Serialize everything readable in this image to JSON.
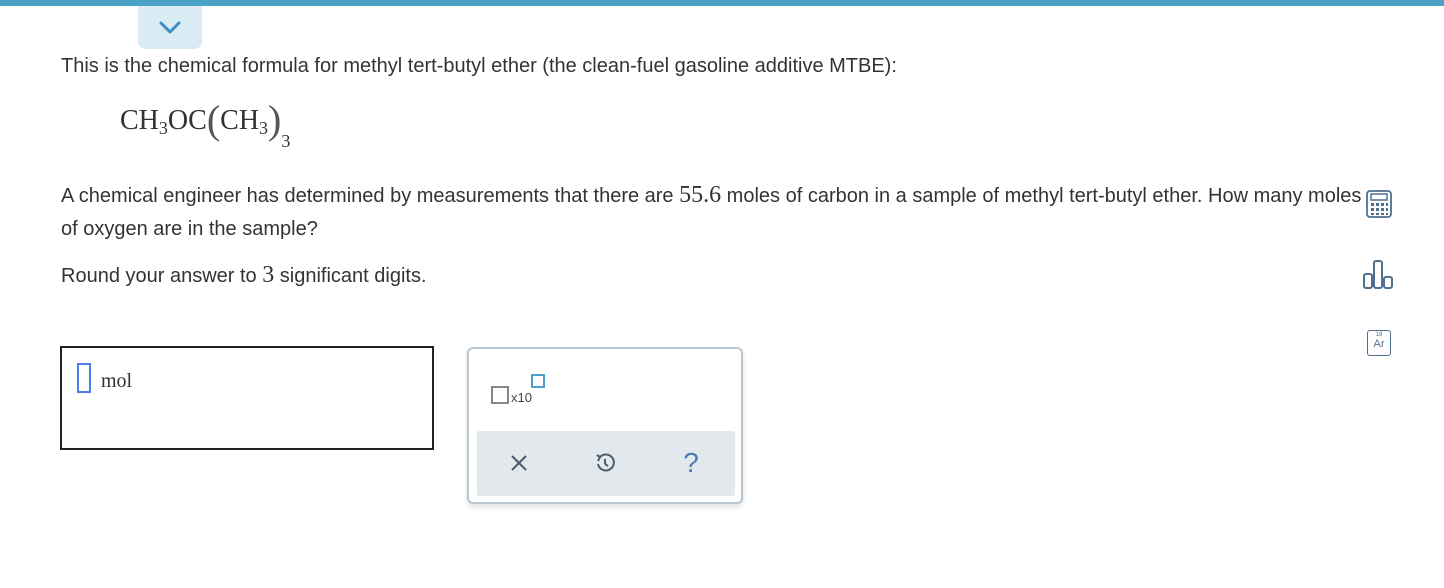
{
  "problem": {
    "intro": "This is the chemical formula for methyl tert-butyl ether (the clean-fuel gasoline additive MTBE):",
    "formula": {
      "part1": "CH",
      "sub1": "3",
      "part2": "OC",
      "open_paren": "(",
      "part3": "CH",
      "sub2": "3",
      "close_paren": ")",
      "sub3": "3"
    },
    "question_before": "A chemical engineer has determined by measurements that there are ",
    "question_value": "55.6",
    "question_after": " moles of carbon in a sample of methyl tert-butyl ether. How many moles of oxygen are in the sample?",
    "round_before": "Round your answer to ",
    "round_value": "3",
    "round_after": " significant digits."
  },
  "answer": {
    "value": "",
    "unit": "mol"
  },
  "toolbox": {
    "sci_notation_label": "x10",
    "clear_icon": "close-icon",
    "undo_icon": "undo-icon",
    "help_label": "?"
  },
  "sidebar": {
    "calculator_icon": "calculator-icon",
    "data_icon": "bar-chart-icon",
    "periodic_number": "18",
    "periodic_symbol": "Ar"
  },
  "colors": {
    "accent": "#4aa3c7",
    "active_slot": "#4d7cf0",
    "icon": "#4f6f8f"
  }
}
